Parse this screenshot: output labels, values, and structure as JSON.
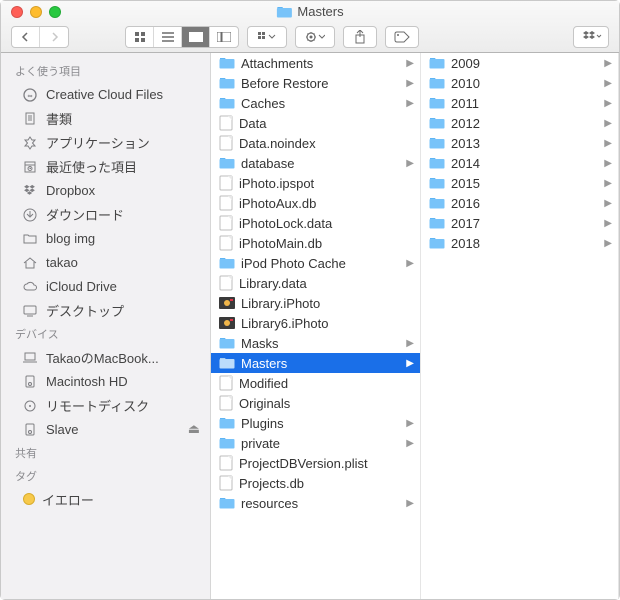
{
  "window": {
    "title": "Masters"
  },
  "sidebar": {
    "sections": [
      {
        "header": "よく使う項目",
        "items": [
          {
            "label": "Creative Cloud Files",
            "icon": "cc"
          },
          {
            "label": "書類",
            "icon": "doc"
          },
          {
            "label": "アプリケーション",
            "icon": "apps"
          },
          {
            "label": "最近使った項目",
            "icon": "clock"
          },
          {
            "label": "Dropbox",
            "icon": "dropbox"
          },
          {
            "label": "ダウンロード",
            "icon": "downloads"
          },
          {
            "label": "blog img",
            "icon": "folder"
          },
          {
            "label": "takao",
            "icon": "home"
          },
          {
            "label": "iCloud Drive",
            "icon": "cloud"
          },
          {
            "label": "デスクトップ",
            "icon": "desktop"
          }
        ]
      },
      {
        "header": "デバイス",
        "items": [
          {
            "label": "TakaoのMacBook...",
            "icon": "laptop"
          },
          {
            "label": "Macintosh HD",
            "icon": "disk"
          },
          {
            "label": "リモートディスク",
            "icon": "remote"
          },
          {
            "label": "Slave",
            "icon": "disk",
            "eject": true
          }
        ]
      },
      {
        "header": "共有",
        "items": []
      },
      {
        "header": "タグ",
        "items": [
          {
            "label": "イエロー",
            "icon": "tag-yellow"
          }
        ]
      }
    ]
  },
  "columns": [
    [
      {
        "name": "Attachments",
        "type": "folder",
        "expandable": true
      },
      {
        "name": "Before Restore",
        "type": "folder",
        "expandable": true
      },
      {
        "name": "Caches",
        "type": "folder",
        "expandable": true
      },
      {
        "name": "Data",
        "type": "file"
      },
      {
        "name": "Data.noindex",
        "type": "file"
      },
      {
        "name": "database",
        "type": "folder",
        "expandable": true
      },
      {
        "name": "iPhoto.ipspot",
        "type": "file"
      },
      {
        "name": "iPhotoAux.db",
        "type": "file"
      },
      {
        "name": "iPhotoLock.data",
        "type": "file"
      },
      {
        "name": "iPhotoMain.db",
        "type": "file"
      },
      {
        "name": "iPod Photo Cache",
        "type": "folder",
        "expandable": true
      },
      {
        "name": "Library.data",
        "type": "file"
      },
      {
        "name": "Library.iPhoto",
        "type": "iphoto"
      },
      {
        "name": "Library6.iPhoto",
        "type": "iphoto"
      },
      {
        "name": "Masks",
        "type": "folder",
        "expandable": true
      },
      {
        "name": "Masters",
        "type": "folder",
        "expandable": true,
        "selected": true
      },
      {
        "name": "Modified",
        "type": "file"
      },
      {
        "name": "Originals",
        "type": "file"
      },
      {
        "name": "Plugins",
        "type": "folder",
        "expandable": true
      },
      {
        "name": "private",
        "type": "folder",
        "expandable": true
      },
      {
        "name": "ProjectDBVersion.plist",
        "type": "file"
      },
      {
        "name": "Projects.db",
        "type": "file"
      },
      {
        "name": "resources",
        "type": "folder",
        "expandable": true
      }
    ],
    [
      {
        "name": "2009",
        "type": "folder",
        "expandable": true
      },
      {
        "name": "2010",
        "type": "folder",
        "expandable": true
      },
      {
        "name": "2011",
        "type": "folder",
        "expandable": true
      },
      {
        "name": "2012",
        "type": "folder",
        "expandable": true
      },
      {
        "name": "2013",
        "type": "folder",
        "expandable": true
      },
      {
        "name": "2014",
        "type": "folder",
        "expandable": true
      },
      {
        "name": "2015",
        "type": "folder",
        "expandable": true
      },
      {
        "name": "2016",
        "type": "folder",
        "expandable": true
      },
      {
        "name": "2017",
        "type": "folder",
        "expandable": true
      },
      {
        "name": "2018",
        "type": "folder",
        "expandable": true
      }
    ]
  ]
}
